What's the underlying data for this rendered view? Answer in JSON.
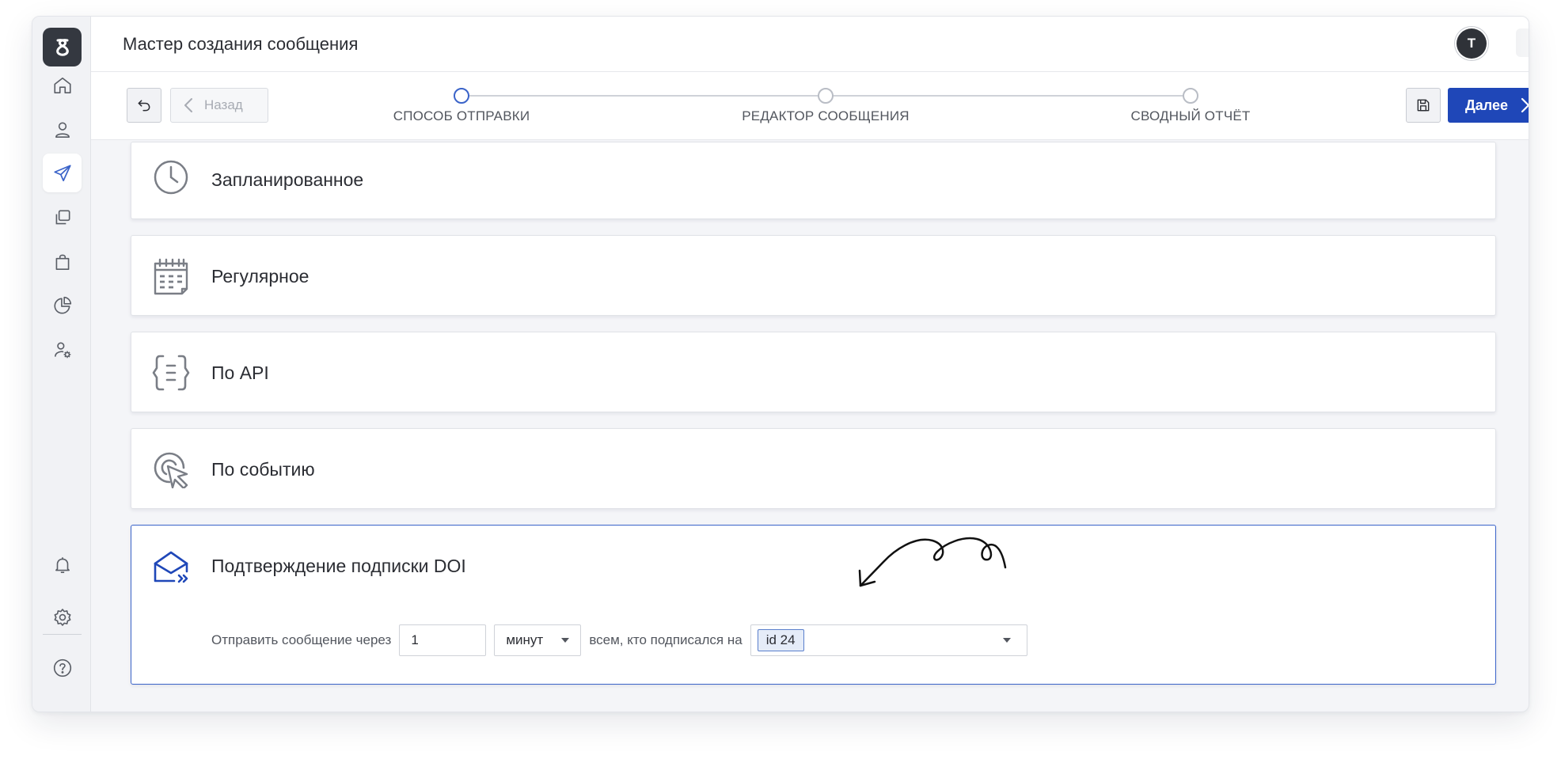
{
  "header": {
    "title": "Мастер создания сообщения",
    "avatar_initial": "T"
  },
  "sidebar": {
    "items": [
      {
        "name": "home",
        "icon": "home-icon"
      },
      {
        "name": "contacts",
        "icon": "user-icon"
      },
      {
        "name": "messages",
        "icon": "paper-plane-icon",
        "active": true
      },
      {
        "name": "templates",
        "icon": "copy-icon"
      },
      {
        "name": "shop",
        "icon": "shopping-bag-icon"
      },
      {
        "name": "analytics",
        "icon": "pie-chart-icon"
      },
      {
        "name": "account-settings",
        "icon": "user-gear-icon"
      },
      {
        "name": "notifications",
        "icon": "bell-icon"
      },
      {
        "name": "settings",
        "icon": "gear-icon"
      },
      {
        "name": "help",
        "icon": "question-icon"
      }
    ]
  },
  "toolbar": {
    "back_label": "Назад",
    "next_label": "Далее",
    "steps": [
      {
        "label": "СПОСОБ ОТПРАВКИ",
        "active": true
      },
      {
        "label": "РЕДАКТОР СООБЩЕНИЯ",
        "active": false
      },
      {
        "label": "СВОДНЫЙ ОТЧЁТ",
        "active": false
      }
    ]
  },
  "options": [
    {
      "title": "Запланированное",
      "icon": "clock-icon"
    },
    {
      "title": "Регулярное",
      "icon": "calendar-icon"
    },
    {
      "title": "По API",
      "icon": "api-braces-icon"
    },
    {
      "title": "По событию",
      "icon": "event-cursor-icon"
    },
    {
      "title": "Подтверждение подписки DOI",
      "icon": "envelope-open-icon",
      "selected": true
    }
  ],
  "doi": {
    "send_after_label": "Отправить сообщение через",
    "delay_value": "1",
    "unit_value": "минут",
    "subscribers_label": "всем, кто подписался на",
    "list_tag": "id 24"
  },
  "colors": {
    "accent": "#1f47b8",
    "selected_border": "#3a63c9",
    "tag_bg": "#e5ecf8"
  }
}
